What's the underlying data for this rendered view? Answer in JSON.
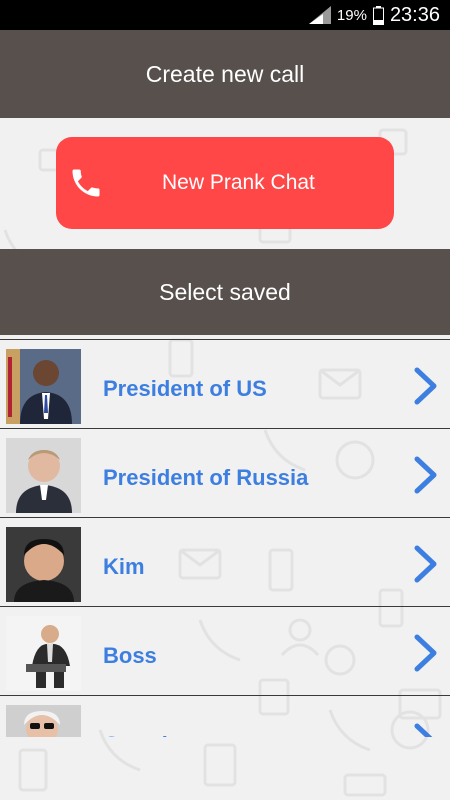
{
  "status_bar": {
    "battery_percent": "19%",
    "time": "23:36"
  },
  "create_section": {
    "title": "Create new call"
  },
  "prank_button": {
    "label": "New Prank Chat",
    "color": "#ff4747"
  },
  "saved_section": {
    "title": "Select saved"
  },
  "contacts": [
    {
      "name": "President of US"
    },
    {
      "name": "President of Russia"
    },
    {
      "name": "Kim"
    },
    {
      "name": "Boss"
    },
    {
      "name": "Grandma"
    }
  ],
  "colors": {
    "header": "#57504d",
    "accent_blue": "#3d7fe0",
    "background": "#f1f1f1"
  }
}
